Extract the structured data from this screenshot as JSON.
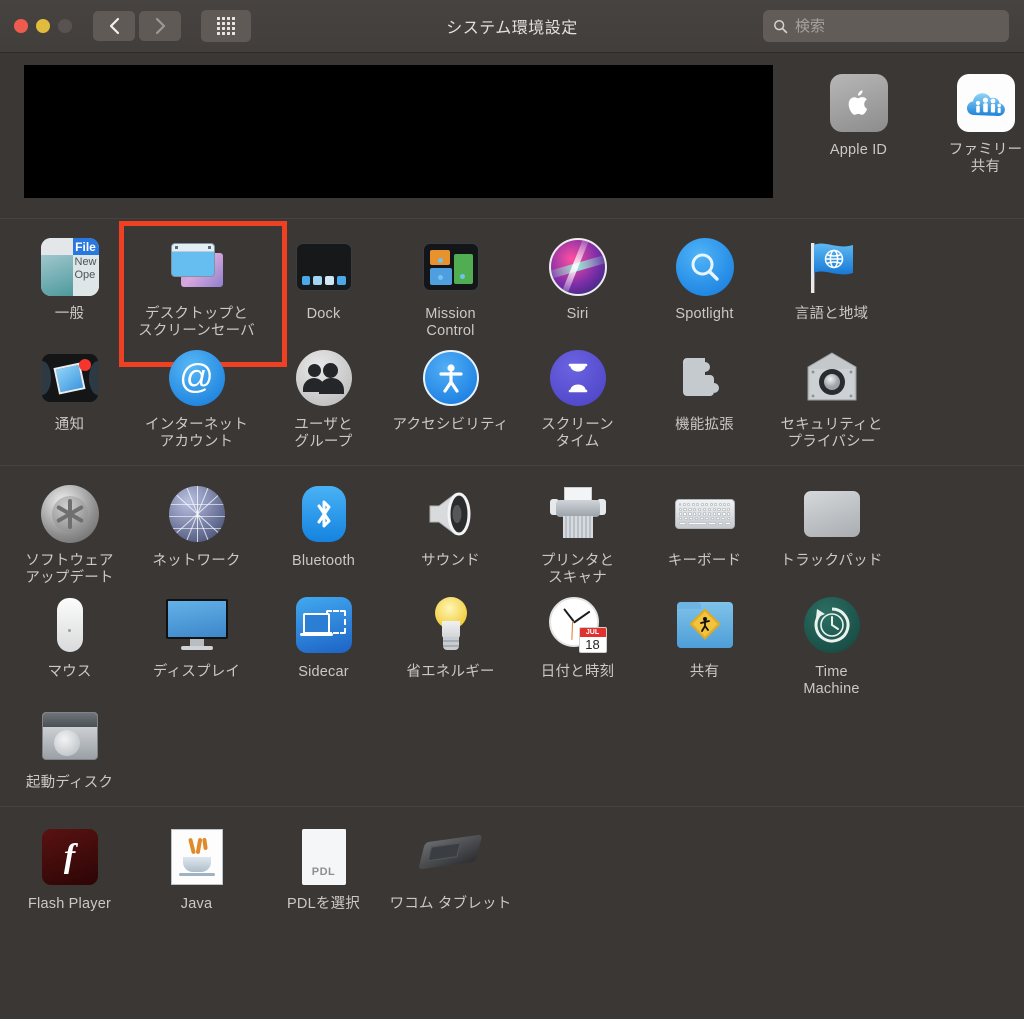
{
  "window": {
    "title": "システム環境設定",
    "traffic_lights": [
      "close",
      "minimize",
      "zoom-disabled"
    ],
    "nav_back": "back",
    "nav_forward": "forward",
    "grid_button": "show-all"
  },
  "search": {
    "placeholder": "検索",
    "value": "",
    "icon": "search-icon"
  },
  "highlight": {
    "target": "デスクトップとスクリーンセーバ",
    "color": "#f04024"
  },
  "sections": [
    {
      "id": "account",
      "redacted_block": true,
      "tiles": [
        {
          "label": "Apple ID",
          "icon": "apple-id-icon"
        },
        {
          "label": "ファミリー\n共有",
          "icon": "family-sharing-icon"
        }
      ]
    },
    {
      "id": "personal",
      "tiles": [
        {
          "label": "一般",
          "icon": "general-icon"
        },
        {
          "label": "デスクトップと\nスクリーンセーバ",
          "icon": "desktop-screensaver-icon",
          "highlighted": true
        },
        {
          "label": "Dock",
          "icon": "dock-icon"
        },
        {
          "label": "Mission\nControl",
          "icon": "mission-control-icon"
        },
        {
          "label": "Siri",
          "icon": "siri-icon"
        },
        {
          "label": "Spotlight",
          "icon": "spotlight-icon"
        },
        {
          "label": "言語と地域",
          "icon": "language-region-icon"
        },
        {
          "label": "通知",
          "icon": "notifications-icon"
        },
        {
          "label": "インターネット\nアカウント",
          "icon": "internet-accounts-icon"
        },
        {
          "label": "ユーザと\nグループ",
          "icon": "users-groups-icon"
        },
        {
          "label": "アクセシビリティ",
          "icon": "accessibility-icon"
        },
        {
          "label": "スクリーン\nタイム",
          "icon": "screen-time-icon"
        },
        {
          "label": "機能拡張",
          "icon": "extensions-icon"
        },
        {
          "label": "セキュリティと\nプライバシー",
          "icon": "security-privacy-icon"
        }
      ]
    },
    {
      "id": "hardware",
      "tiles": [
        {
          "label": "ソフトウェア\nアップデート",
          "icon": "software-update-icon"
        },
        {
          "label": "ネットワーク",
          "icon": "network-icon"
        },
        {
          "label": "Bluetooth",
          "icon": "bluetooth-icon"
        },
        {
          "label": "サウンド",
          "icon": "sound-icon"
        },
        {
          "label": "プリンタと\nスキャナ",
          "icon": "printers-scanners-icon"
        },
        {
          "label": "キーボード",
          "icon": "keyboard-icon"
        },
        {
          "label": "トラックパッド",
          "icon": "trackpad-icon"
        },
        {
          "label": "マウス",
          "icon": "mouse-icon"
        },
        {
          "label": "ディスプレイ",
          "icon": "displays-icon"
        },
        {
          "label": "Sidecar",
          "icon": "sidecar-icon"
        },
        {
          "label": "省エネルギー",
          "icon": "energy-saver-icon"
        },
        {
          "label": "日付と時刻",
          "icon": "date-time-icon"
        },
        {
          "label": "共有",
          "icon": "sharing-icon"
        },
        {
          "label": "Time\nMachine",
          "icon": "time-machine-icon"
        },
        {
          "label": "起動ディスク",
          "icon": "startup-disk-icon"
        }
      ]
    },
    {
      "id": "third-party",
      "tiles": [
        {
          "label": "Flash Player",
          "icon": "flash-player-icon"
        },
        {
          "label": "Java",
          "icon": "java-icon"
        },
        {
          "label": "PDLを選択",
          "icon": "pdl-icon"
        },
        {
          "label": "ワコム タブレット",
          "icon": "wacom-tablet-icon"
        }
      ]
    }
  ],
  "icon_details": {
    "general_menu": {
      "file": "File",
      "new": "New",
      "open": "Ope"
    },
    "date_calendar": {
      "month": "JUL",
      "day": "18"
    },
    "pdl_label": "PDL"
  }
}
